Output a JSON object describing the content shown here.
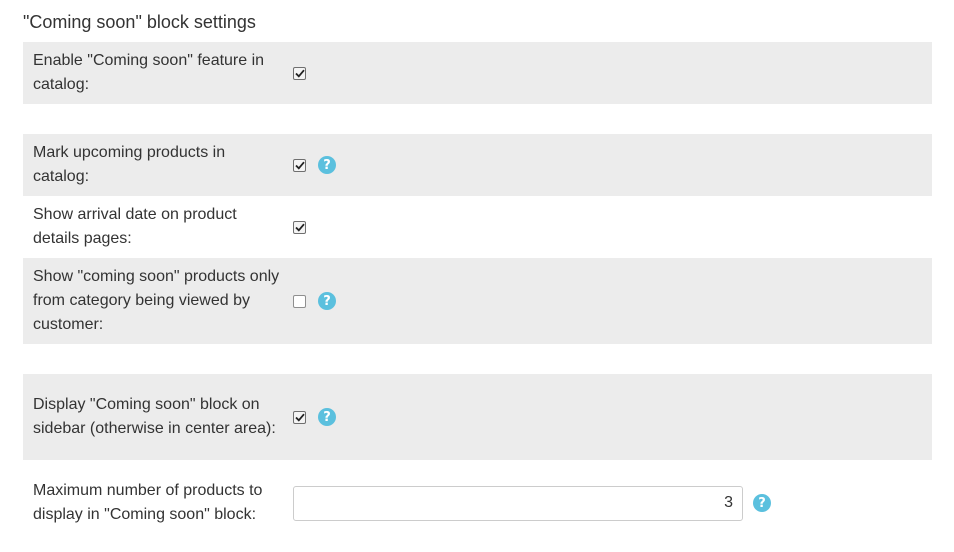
{
  "section": {
    "title": "\"Coming soon\" block settings"
  },
  "settings": [
    {
      "label": "Enable \"Coming soon\" feature in catalog:",
      "checked": true,
      "help": false
    },
    {
      "label": "Mark upcoming products in catalog:",
      "checked": true,
      "help": true
    },
    {
      "label": "Show arrival date on product details pages:",
      "checked": true,
      "help": false
    },
    {
      "label": "Show \"coming soon\" products only from category being viewed by customer:",
      "checked": false,
      "help": true
    },
    {
      "label": "Display \"Coming soon\" block on sidebar (otherwise in center area):",
      "checked": true,
      "help": true
    },
    {
      "label": "Maximum number of products to display in \"Coming soon\" block:",
      "value": "3",
      "help": true
    }
  ],
  "help_icon": "question-circle-icon",
  "colors": {
    "row_shade": "#ececec",
    "help_icon": "#5bc0de"
  }
}
